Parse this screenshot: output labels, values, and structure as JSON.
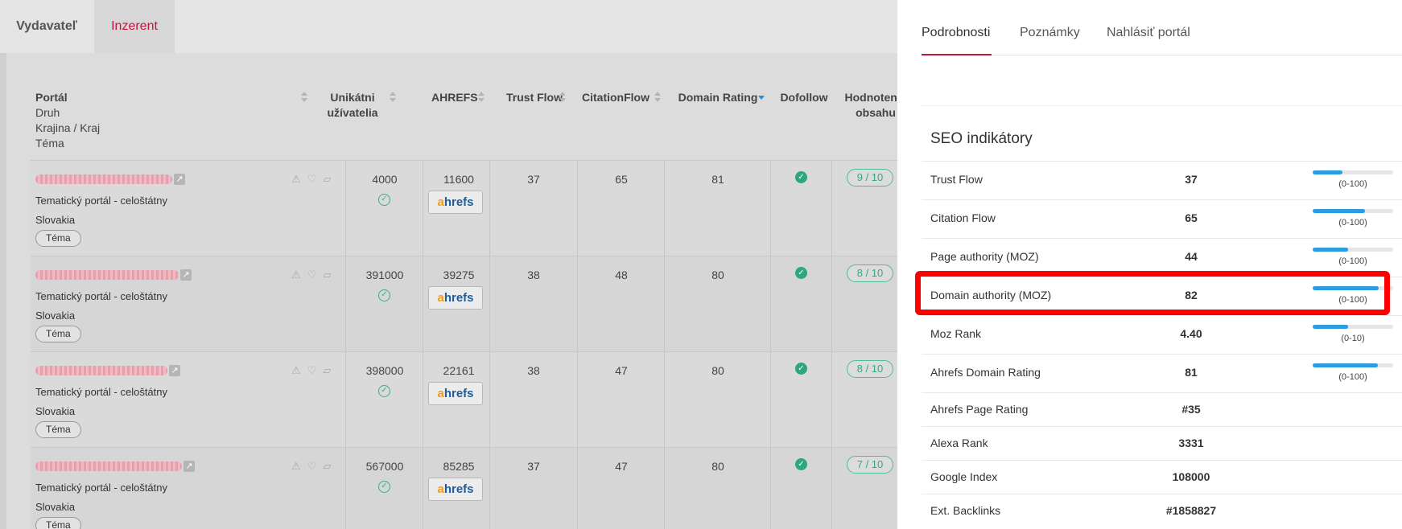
{
  "top_tabs": [
    "Vydavateľ",
    "Inzerent"
  ],
  "columns": {
    "portal": "Portál",
    "portal_sub": [
      "Druh",
      "Krajina / Kraj",
      "Téma"
    ],
    "unique_users": [
      "Unikátni",
      "užívatelia"
    ],
    "ahrefs": "AHREFS",
    "trust_flow": "Trust Flow",
    "citation_flow": "CitationFlow",
    "domain_rating": "Domain Rating",
    "dofollow": "Dofollow",
    "content_rating": [
      "Hodnotenie",
      "obsahu"
    ]
  },
  "rows": [
    {
      "type": "Tematický portál - celoštátny",
      "country": "Slovakia",
      "tag": "Téma",
      "users": "4000",
      "ahrefs": "11600",
      "tf": "37",
      "cf": "65",
      "dr": "81",
      "score": "9 / 10"
    },
    {
      "type": "Tematický portál - celoštátny",
      "country": "Slovakia",
      "tag": "Téma",
      "users": "391000",
      "ahrefs": "39275",
      "tf": "38",
      "cf": "48",
      "dr": "80",
      "score": "8 / 10"
    },
    {
      "type": "Tematický portál - celoštátny",
      "country": "Slovakia",
      "tag": "Téma",
      "users": "398000",
      "ahrefs": "22161",
      "tf": "38",
      "cf": "47",
      "dr": "80",
      "score": "8 / 10"
    },
    {
      "type": "Tematický portál - celoštátny",
      "country": "Slovakia",
      "tag": "Téma",
      "users": "567000",
      "ahrefs": "85285",
      "tf": "37",
      "cf": "47",
      "dr": "80",
      "score": "7 / 10"
    }
  ],
  "ahrefs_logo": {
    "a": "a",
    "rest": "hrefs"
  },
  "panel": {
    "tabs": [
      "Podrobnosti",
      "Poznámky",
      "Nahlásiť portál"
    ],
    "seo_title": "SEO indikátory",
    "metrics": [
      {
        "label": "Trust Flow",
        "value": "37",
        "range": "(0-100)",
        "fill": 0.37
      },
      {
        "label": "Citation Flow",
        "value": "65",
        "range": "(0-100)",
        "fill": 0.65
      },
      {
        "label": "Page authority (MOZ)",
        "value": "44",
        "range": "(0-100)",
        "fill": 0.44
      },
      {
        "label": "Domain authority (MOZ)",
        "value": "82",
        "range": "(0-100)",
        "fill": 0.82
      },
      {
        "label": "Moz Rank",
        "value": "4.40",
        "range": "(0-10)",
        "fill": 0.44
      },
      {
        "label": "Ahrefs Domain Rating",
        "value": "81",
        "range": "(0-100)",
        "fill": 0.81
      },
      {
        "label": "Ahrefs Page Rating",
        "value": "#35"
      },
      {
        "label": "Alexa Rank",
        "value": "3331"
      },
      {
        "label": "Google Index",
        "value": "108000"
      },
      {
        "label": "Ext. Backlinks",
        "value": "#1858827"
      }
    ]
  },
  "colors": {
    "accent": "#c0163b",
    "bar": "#2a9ce0",
    "check": "#2ea77c",
    "highlight": "#ff0000"
  }
}
